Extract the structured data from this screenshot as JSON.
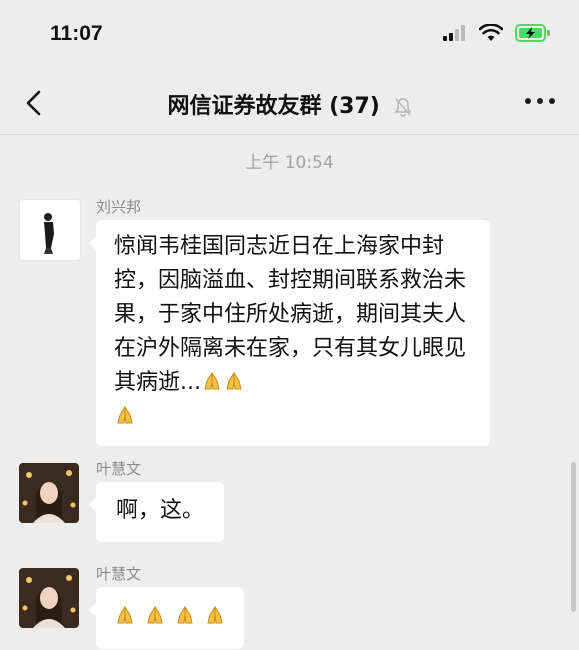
{
  "status_bar": {
    "time": "11:07"
  },
  "header": {
    "title": "网信证券故友群 (37)"
  },
  "chat": {
    "timestamp": "上午 10:54",
    "messages": [
      {
        "sender": "刘兴邦",
        "text": "惊闻韦桂国同志近日在上海家中封控，因脑溢血、封控期间联系救治未果，于家中住所处病逝，期间其夫人在沪外隔离未在家，只有其女儿眼见其病逝...",
        "emoji": "🙏🙏🙏"
      },
      {
        "sender": "叶慧文",
        "text": "啊，这。"
      },
      {
        "sender": "叶慧文",
        "text": "",
        "emoji": "🙏🙏🙏🙏"
      }
    ]
  },
  "colors": {
    "background": "#ededed",
    "bubble": "#ffffff",
    "battery": "#4cd964"
  },
  "icons": [
    "signal-icon",
    "wifi-icon",
    "battery-charging-icon",
    "back-chevron-icon",
    "mute-bell-icon",
    "more-icon",
    "pray-emoji-icon"
  ]
}
